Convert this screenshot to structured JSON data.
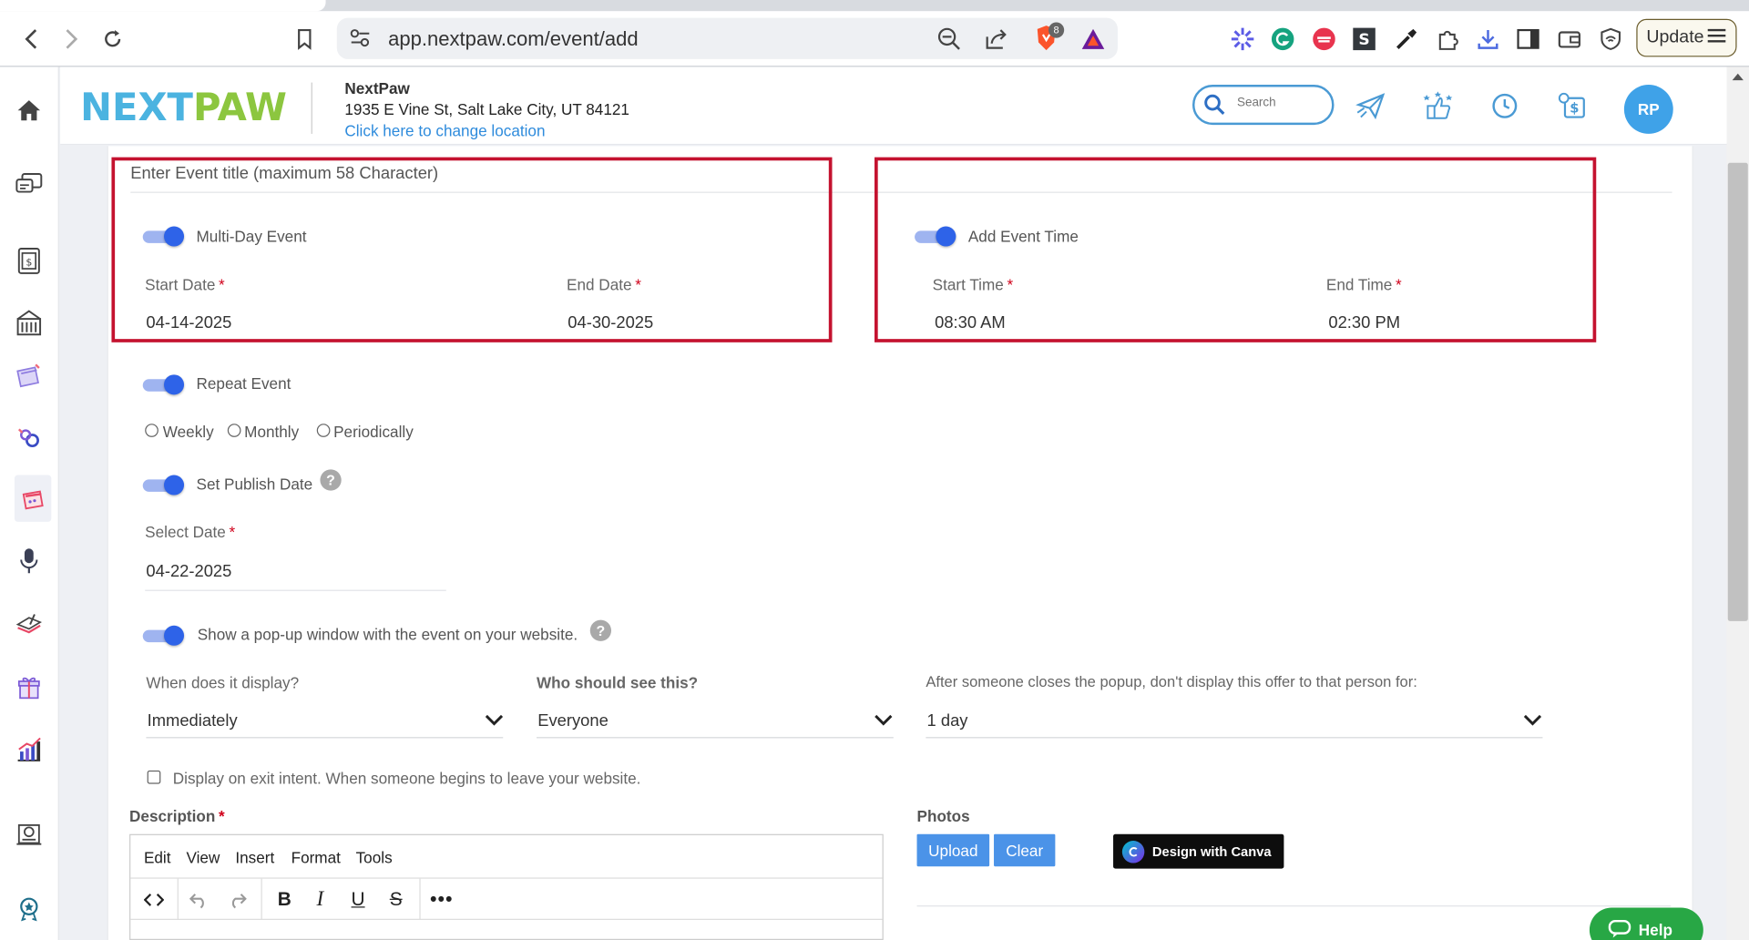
{
  "browser": {
    "url": "app.nextpaw.com/event/add",
    "update_label": "Update",
    "brave_badge": "8"
  },
  "header": {
    "logo_next": "NEXT",
    "logo_paw": "PAW",
    "business_name": "NextPaw",
    "business_address": "1935 E Vine St, Salt Lake City, UT 84121",
    "change_location": "Click here to change location",
    "search_placeholder": "Search",
    "avatar_initials": "RP"
  },
  "form": {
    "title_placeholder": "Enter Event title (maximum 58 Character)",
    "multi_day_label": "Multi-Day Event",
    "start_date_label": "Start Date",
    "start_date_value": "04-14-2025",
    "end_date_label": "End Date",
    "end_date_value": "04-30-2025",
    "add_time_label": "Add Event Time",
    "start_time_label": "Start Time",
    "start_time_value": "08:30 AM",
    "end_time_label": "End Time",
    "end_time_value": "02:30 PM",
    "required_mark": "*",
    "repeat_label": "Repeat Event",
    "repeat_options": [
      "Weekly",
      "Monthly",
      "Periodically"
    ],
    "publish_label": "Set Publish Date",
    "help_mark": "?",
    "select_date_label": "Select Date",
    "select_date_value": "04-22-2025",
    "popup_label": "Show a pop-up window with the event on your website.",
    "when_label": "When does it display?",
    "when_value": "Immediately",
    "who_label": "Who should see this?",
    "who_value": "Everyone",
    "after_close_label": "After someone closes the popup, don't display this offer to that person for:",
    "after_close_value": "1 day",
    "exit_intent_label": "Display on exit intent. When someone begins to leave your website.",
    "description_label": "Description",
    "editor_menu": [
      "Edit",
      "View",
      "Insert",
      "Format",
      "Tools"
    ],
    "photos_label": "Photos",
    "upload_label": "Upload",
    "clear_label": "Clear",
    "canva_label": "Design with Canva"
  },
  "help_button": "Help",
  "colors": {
    "accent": "#2e63e8",
    "highlight_box": "#c4122f",
    "brand_blue": "#4bb3e0",
    "brand_green": "#8cc63f",
    "help_green": "#28a745"
  }
}
